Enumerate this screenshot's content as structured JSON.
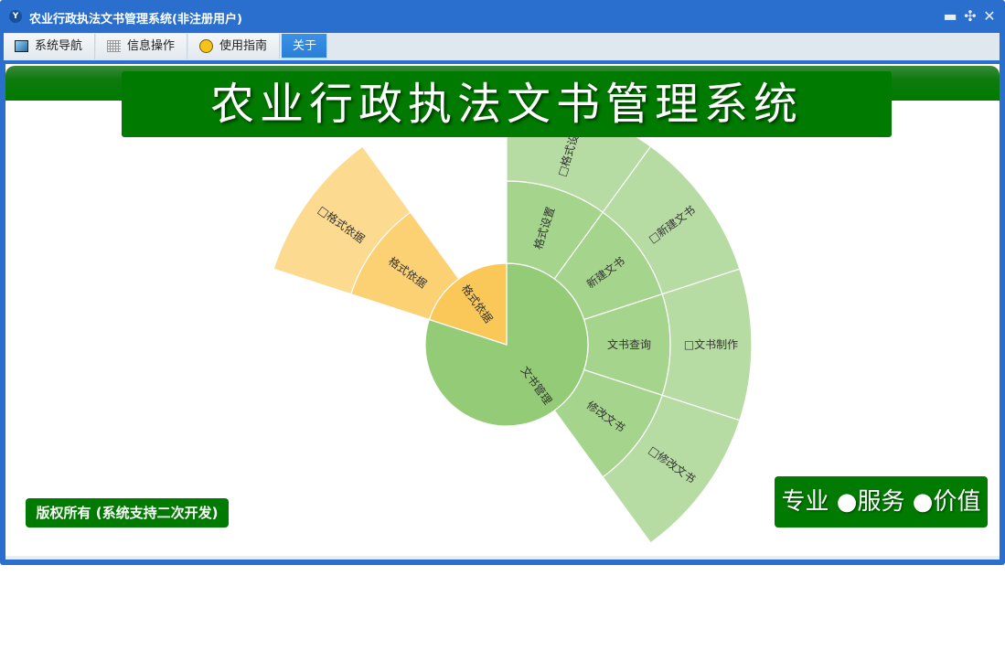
{
  "window": {
    "title": "农业行政执法文书管理系统(非注册用户)",
    "app_icon": "Y",
    "controls": {
      "minimize": "minimize-icon",
      "restore": "restore-icon",
      "close": "close-icon"
    }
  },
  "tabs": [
    {
      "label": "系统导航",
      "icon": "monitor-icon",
      "active": false
    },
    {
      "label": "信息操作",
      "icon": "grid-icon",
      "active": false
    },
    {
      "label": "使用指南",
      "icon": "help-icon",
      "active": false
    },
    {
      "label": "关于",
      "active": true
    }
  ],
  "banner": {
    "title": "农业行政执法文书管理系统"
  },
  "footer": {
    "copyright": "版权所有 (系统支持二次开发)",
    "slogan": "专业 ●服务 ●价值"
  },
  "colors": {
    "accent": "#2a6fce",
    "brand_green": "#007a00"
  },
  "chart_data": {
    "type": "sunburst",
    "data": [
      {
        "name": "文书管理",
        "value": 8,
        "color": "#93cb76",
        "children": [
          {
            "name": "格式设置",
            "value": 1,
            "children": [
              {
                "name": "□格式设置",
                "value": 1
              }
            ]
          },
          {
            "name": "新建文书",
            "value": 1,
            "children": [
              {
                "name": "□新建文书",
                "value": 1
              }
            ]
          },
          {
            "name": "文书查询",
            "value": 1,
            "children": [
              {
                "name": "□文书制作",
                "value": 1
              }
            ]
          },
          {
            "name": "修改文书",
            "value": 1,
            "children": [
              {
                "name": "□修改文书",
                "value": 1
              }
            ]
          }
        ]
      },
      {
        "name": "格式依据",
        "value": 2,
        "color": "#fac858",
        "children": [
          {
            "name": "格式依据",
            "value": 1,
            "children": [
              {
                "name": "□格式依据",
                "value": 1
              }
            ]
          }
        ]
      }
    ]
  }
}
